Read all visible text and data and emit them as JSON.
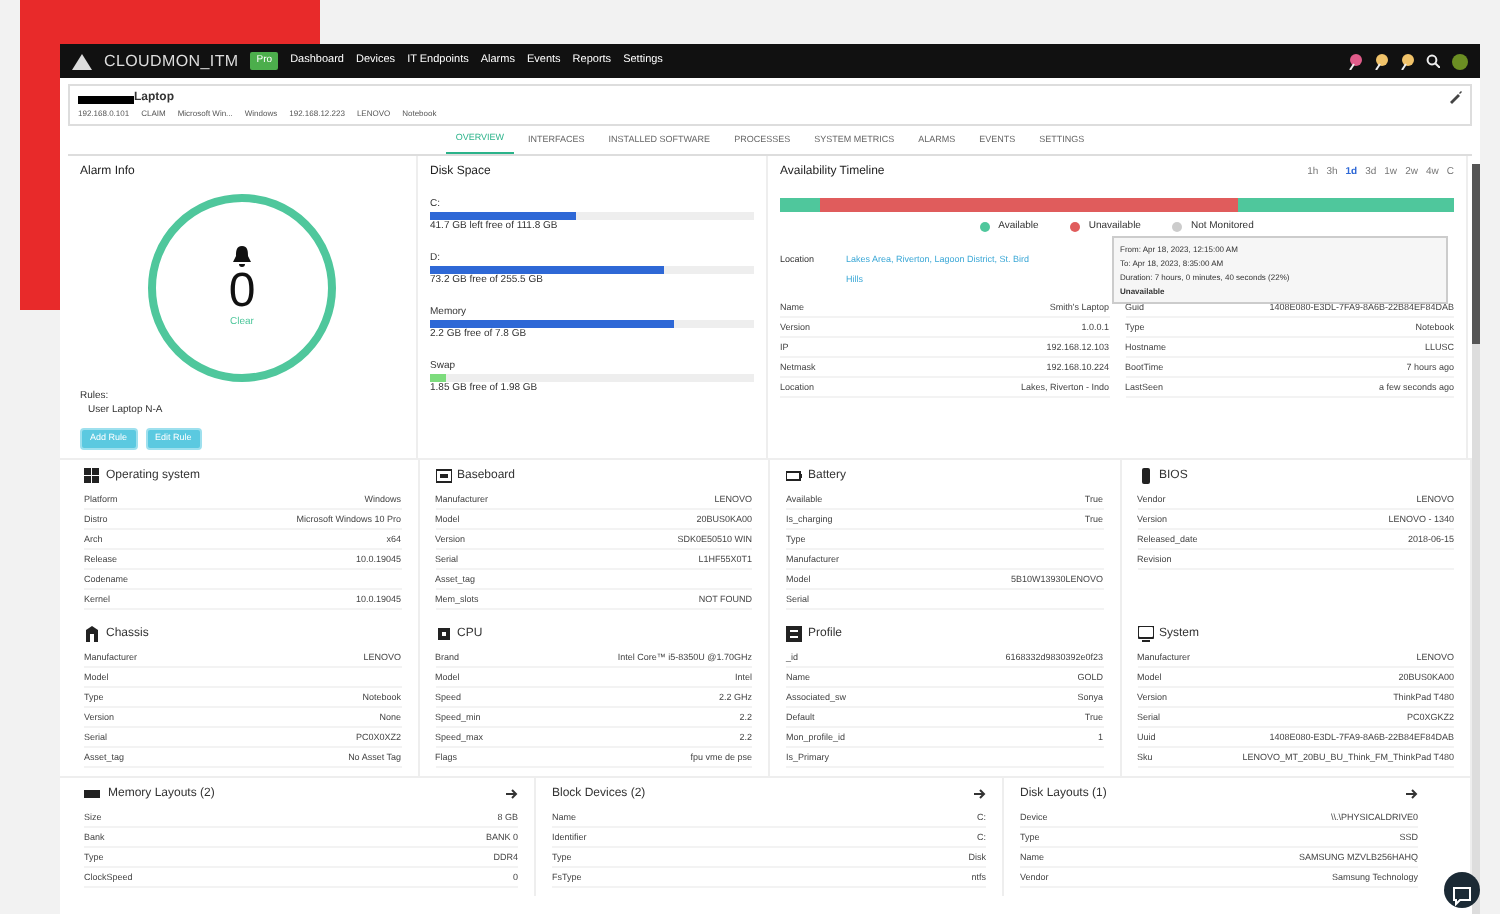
{
  "navbar": {
    "brand": "CLOUDMON_ITM",
    "badge": "Pro",
    "links": [
      "Dashboard",
      "Devices",
      "IT Endpoints",
      "Alarms",
      "Events",
      "Reports",
      "Settings"
    ]
  },
  "device": {
    "name": "Laptop",
    "meta": [
      "192.168.0.101",
      "CLAIM",
      "Microsoft Win...",
      "Windows",
      "192.168.12.223",
      "LENOVO",
      "Notebook"
    ]
  },
  "tabs": [
    {
      "label": "OVERVIEW",
      "selected": true
    },
    {
      "label": "INTERFACES",
      "selected": false
    },
    {
      "label": "INSTALLED SOFTWARE",
      "selected": false
    },
    {
      "label": "PROCESSES",
      "selected": false
    },
    {
      "label": "SYSTEM METRICS",
      "selected": false
    },
    {
      "label": "ALARMS",
      "selected": false
    },
    {
      "label": "EVENTS",
      "selected": false
    },
    {
      "label": "SETTINGS",
      "selected": false
    }
  ],
  "alarm_info": {
    "title": "Alarm Info",
    "count": "0",
    "status": "Clear",
    "rules_label": "Rules:",
    "rule": "User Laptop N-A",
    "buttons": [
      "Add Rule",
      "Edit Rule"
    ]
  },
  "disk_space": {
    "title": "Disk Space",
    "items": [
      {
        "name": "C:",
        "level": 0.45,
        "reading": "41.7 GB left free of 111.8 GB"
      },
      {
        "name": "D:",
        "level": 0.72,
        "reading": "73.2 GB free of 255.5 GB"
      },
      {
        "name": "Memory",
        "level": 0.75,
        "reading": "2.2 GB free of 7.8 GB"
      },
      {
        "name": "Swap",
        "level": 0.05,
        "reading": "1.85 GB free of 1.98 GB"
      }
    ]
  },
  "availability": {
    "title": "Availability Timeline",
    "ranges": [
      {
        "label": "1h",
        "selected": false
      },
      {
        "label": "3h",
        "selected": false
      },
      {
        "label": "1d",
        "selected": true
      },
      {
        "label": "3d",
        "selected": false
      },
      {
        "label": "1w",
        "selected": false
      },
      {
        "label": "2w",
        "selected": false
      },
      {
        "label": "4w",
        "selected": false
      },
      {
        "label": "C",
        "selected": false
      }
    ],
    "segments": [
      {
        "color": "#4fc79c"
      },
      {
        "color": "#e05c5c"
      },
      {
        "color": "#4fc79c"
      }
    ],
    "legend": [
      {
        "label": "Available",
        "color": "#4fc79c"
      },
      {
        "label": "Unavailable",
        "color": "#e05c5c"
      },
      {
        "label": "Not Monitored",
        "color": "#cccccc"
      }
    ],
    "tooltip": [
      "From: Apr 18, 2023, 12:15:00 AM",
      "To: Apr 18, 2023, 8:35:00 AM",
      "Duration: 7 hours, 0 minutes, 40 seconds (22%)",
      "Unavailable"
    ],
    "location": {
      "label": "Location",
      "value": "Lakes Area, Riverton, Lagoon District, St. Bird Hills"
    },
    "rows": [
      {
        "label": "Name",
        "value": "Smith's Laptop",
        "label2": "Guid",
        "value2": "1408E080-E3DL-7FA9-8A6B-22B84EF84DAB"
      },
      {
        "label": "Version",
        "value": "1.0.0.1",
        "label2": "Type",
        "value2": "Notebook"
      },
      {
        "label": "IP",
        "value": "192.168.12.103",
        "label2": "Hostname",
        "value2": "LLUSC"
      },
      {
        "label": "Netmask",
        "value": "192.168.10.224",
        "label2": "BootTime",
        "value2": "7 hours ago"
      },
      {
        "label": "Location",
        "value": "Lakes, Riverton - Indo",
        "label2": "LastSeen",
        "value2": "a few seconds ago"
      }
    ]
  },
  "panels": [
    {
      "kind": "os",
      "title": "Operating system",
      "rows": [
        [
          "Platform",
          "Windows"
        ],
        [
          "Distro",
          "Microsoft Windows 10 Pro"
        ],
        [
          "Arch",
          "x64"
        ],
        [
          "Release",
          "10.0.19045"
        ],
        [
          "Codename",
          ""
        ],
        [
          "Kernel",
          "10.0.19045"
        ]
      ]
    },
    {
      "kind": "board",
      "title": "Baseboard",
      "rows": [
        [
          "Manufacturer",
          "LENOVO"
        ],
        [
          "Model",
          "20BUS0KA00"
        ],
        [
          "Version",
          "SDK0E50510 WIN"
        ],
        [
          "Serial",
          "L1HF55X0T1"
        ],
        [
          "Asset_tag",
          ""
        ],
        [
          "Mem_slots",
          "NOT FOUND"
        ]
      ]
    },
    {
      "kind": "battery",
      "title": "Battery",
      "rows": [
        [
          "Available",
          "True"
        ],
        [
          "Is_charging",
          "True"
        ],
        [
          "Type",
          ""
        ],
        [
          "Manufacturer",
          ""
        ],
        [
          "Model",
          "5B10W13930LENOVO"
        ],
        [
          "Serial",
          ""
        ]
      ]
    },
    {
      "kind": "bios",
      "title": "BIOS",
      "rows": [
        [
          "Vendor",
          "LENOVO"
        ],
        [
          "Version",
          "LENOVO - 1340"
        ],
        [
          "Released_date",
          "2018-06-15"
        ],
        [
          "Revision",
          ""
        ]
      ]
    },
    {
      "kind": "chassis",
      "title": "Chassis",
      "rows": [
        [
          "Manufacturer",
          "LENOVO"
        ],
        [
          "Model",
          ""
        ],
        [
          "Type",
          "Notebook"
        ],
        [
          "Version",
          "None"
        ],
        [
          "Serial",
          "PC0X0XZ2"
        ],
        [
          "Asset_tag",
          "No Asset Tag"
        ]
      ]
    },
    {
      "kind": "cpu",
      "title": "CPU",
      "rows": [
        [
          "Brand",
          "Intel Core™ i5-8350U @1.70GHz"
        ],
        [
          "Model",
          "Intel"
        ],
        [
          "Speed",
          "2.2 GHz"
        ],
        [
          "Speed_min",
          "2.2"
        ],
        [
          "Speed_max",
          "2.2"
        ],
        [
          "Flags",
          "fpu vme de pse"
        ]
      ]
    },
    {
      "kind": "profile",
      "title": "Profile",
      "rows": [
        [
          "_id",
          "6168332d9830392e0f23"
        ],
        [
          "Name",
          "GOLD"
        ],
        [
          "Associated_sw",
          "Sonya"
        ],
        [
          "Default",
          "True"
        ],
        [
          "Mon_profile_id",
          "1"
        ],
        [
          "Is_Primary",
          ""
        ]
      ]
    },
    {
      "kind": "system",
      "title": "System",
      "rows": [
        [
          "Manufacturer",
          "LENOVO"
        ],
        [
          "Model",
          "20BUS0KA00"
        ],
        [
          "Version",
          "ThinkPad T480"
        ],
        [
          "Serial",
          "PC0XGKZ2"
        ],
        [
          "Uuid",
          "1408E080-E3DL-7FA9-8A6B-22B84EF84DAB"
        ],
        [
          "Sku",
          "LENOVO_MT_20BU_BU_Think_FM_ThinkPad T480"
        ]
      ]
    }
  ],
  "collapsibles": [
    {
      "kind": "memory",
      "title": "Memory Layouts (2)",
      "rows": [
        [
          "Size",
          "8 GB"
        ],
        [
          "Bank",
          "BANK 0"
        ],
        [
          "Type",
          "DDR4"
        ],
        [
          "ClockSpeed",
          "0"
        ]
      ]
    },
    {
      "kind": "plain",
      "title": "Block Devices (2)",
      "rows": [
        [
          "Name",
          "C:"
        ],
        [
          "Identifier",
          "C:"
        ],
        [
          "Type",
          "Disk"
        ],
        [
          "FsType",
          "ntfs"
        ]
      ]
    },
    {
      "kind": "plain",
      "title": "Disk Layouts (1)",
      "rows": [
        [
          "Device",
          "\\\\.\\PHYSICALDRIVE0"
        ],
        [
          "Type",
          "SSD"
        ],
        [
          "Name",
          "SAMSUNG MZVLB256HAHQ"
        ],
        [
          "Vendor",
          "Samsung Technology"
        ]
      ]
    }
  ]
}
